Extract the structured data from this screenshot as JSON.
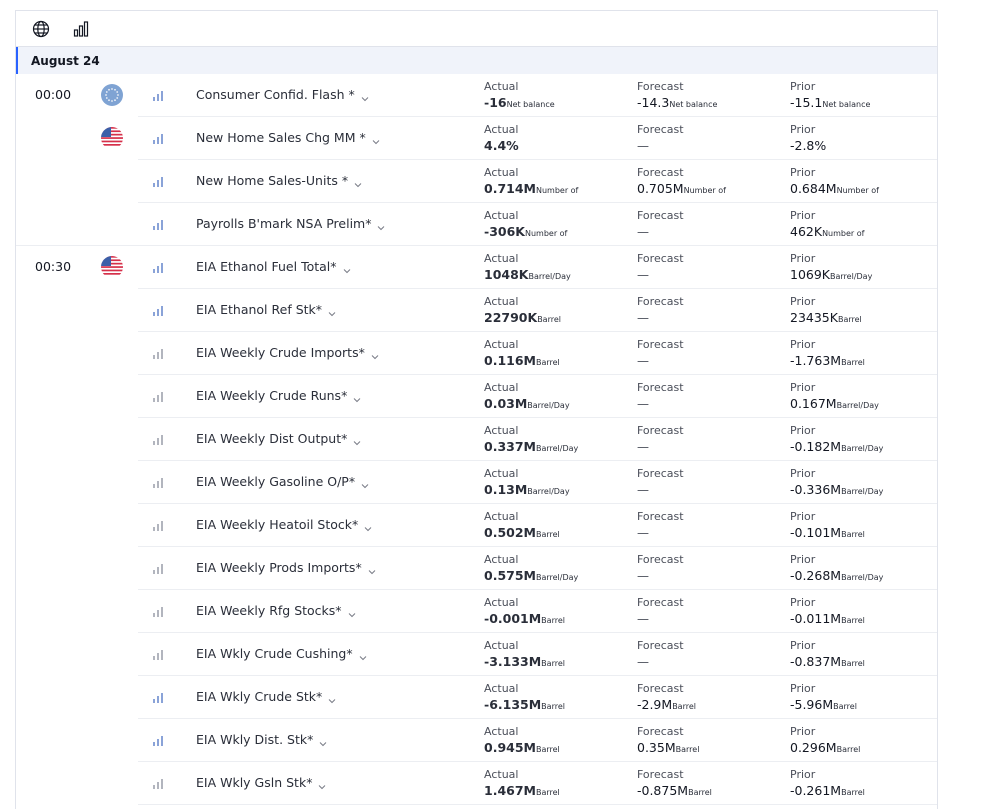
{
  "toolbar": {
    "icons": [
      "globe-icon",
      "importance-bars-icon"
    ]
  },
  "date_header": "August 24",
  "labels": {
    "actual": "Actual",
    "forecast": "Forecast",
    "prior": "Prior"
  },
  "colors": {
    "accent": "#2962ff",
    "importance_high": "#8aa3d8",
    "importance_low": "#b2b5be"
  },
  "events": [
    {
      "time": "00:00",
      "flag": "eu",
      "importance": "high",
      "name": "Consumer Confid. Flash *",
      "actual": {
        "v": "-16",
        "u": "Net balance"
      },
      "forecast": {
        "v": "-14.3",
        "u": "Net balance"
      },
      "prior": {
        "v": "-15.1",
        "u": "Net balance"
      }
    },
    {
      "time": "",
      "flag": "us",
      "importance": "high",
      "name": "New Home Sales Chg MM *",
      "actual": {
        "v": "4.4%",
        "u": ""
      },
      "forecast": {
        "v": "—",
        "u": ""
      },
      "prior": {
        "v": "-2.8%",
        "u": ""
      }
    },
    {
      "time": "",
      "flag": "",
      "importance": "high",
      "name": "New Home Sales-Units *",
      "actual": {
        "v": "0.714M",
        "u": "Number of"
      },
      "forecast": {
        "v": "0.705M",
        "u": "Number of"
      },
      "prior": {
        "v": "0.684M",
        "u": "Number of"
      }
    },
    {
      "time": "",
      "flag": "",
      "importance": "high",
      "name": "Payrolls B'mark NSA Prelim*",
      "actual": {
        "v": "-306K",
        "u": "Number of"
      },
      "forecast": {
        "v": "—",
        "u": ""
      },
      "prior": {
        "v": "462K",
        "u": "Number of"
      }
    },
    {
      "time": "00:30",
      "flag": "us",
      "importance": "high",
      "name": "EIA Ethanol Fuel Total*",
      "actual": {
        "v": "1048K",
        "u": "Barrel/Day"
      },
      "forecast": {
        "v": "—",
        "u": ""
      },
      "prior": {
        "v": "1069K",
        "u": "Barrel/Day"
      }
    },
    {
      "time": "",
      "flag": "",
      "importance": "high",
      "name": "EIA Ethanol Ref Stk*",
      "actual": {
        "v": "22790K",
        "u": "Barrel"
      },
      "forecast": {
        "v": "—",
        "u": ""
      },
      "prior": {
        "v": "23435K",
        "u": "Barrel"
      }
    },
    {
      "time": "",
      "flag": "",
      "importance": "low",
      "name": "EIA Weekly Crude Imports*",
      "actual": {
        "v": "0.116M",
        "u": "Barrel"
      },
      "forecast": {
        "v": "—",
        "u": ""
      },
      "prior": {
        "v": "-1.763M",
        "u": "Barrel"
      }
    },
    {
      "time": "",
      "flag": "",
      "importance": "low",
      "name": "EIA Weekly Crude Runs*",
      "actual": {
        "v": "0.03M",
        "u": "Barrel/Day"
      },
      "forecast": {
        "v": "—",
        "u": ""
      },
      "prior": {
        "v": "0.167M",
        "u": "Barrel/Day"
      }
    },
    {
      "time": "",
      "flag": "",
      "importance": "low",
      "name": "EIA Weekly Dist Output*",
      "actual": {
        "v": "0.337M",
        "u": "Barrel/Day"
      },
      "forecast": {
        "v": "—",
        "u": ""
      },
      "prior": {
        "v": "-0.182M",
        "u": "Barrel/Day"
      }
    },
    {
      "time": "",
      "flag": "",
      "importance": "low",
      "name": "EIA Weekly Gasoline O/P*",
      "actual": {
        "v": "0.13M",
        "u": "Barrel/Day"
      },
      "forecast": {
        "v": "—",
        "u": ""
      },
      "prior": {
        "v": "-0.336M",
        "u": "Barrel/Day"
      }
    },
    {
      "time": "",
      "flag": "",
      "importance": "low",
      "name": "EIA Weekly Heatoil Stock*",
      "actual": {
        "v": "0.502M",
        "u": "Barrel"
      },
      "forecast": {
        "v": "—",
        "u": ""
      },
      "prior": {
        "v": "-0.101M",
        "u": "Barrel"
      }
    },
    {
      "time": "",
      "flag": "",
      "importance": "low",
      "name": "EIA Weekly Prods Imports*",
      "actual": {
        "v": "0.575M",
        "u": "Barrel/Day"
      },
      "forecast": {
        "v": "—",
        "u": ""
      },
      "prior": {
        "v": "-0.268M",
        "u": "Barrel/Day"
      }
    },
    {
      "time": "",
      "flag": "",
      "importance": "low",
      "name": "EIA Weekly Rfg Stocks*",
      "actual": {
        "v": "-0.001M",
        "u": "Barrel"
      },
      "forecast": {
        "v": "—",
        "u": ""
      },
      "prior": {
        "v": "-0.011M",
        "u": "Barrel"
      }
    },
    {
      "time": "",
      "flag": "",
      "importance": "low",
      "name": "EIA Wkly Crude Cushing*",
      "actual": {
        "v": "-3.133M",
        "u": "Barrel"
      },
      "forecast": {
        "v": "—",
        "u": ""
      },
      "prior": {
        "v": "-0.837M",
        "u": "Barrel"
      }
    },
    {
      "time": "",
      "flag": "",
      "importance": "high",
      "name": "EIA Wkly Crude Stk*",
      "actual": {
        "v": "-6.135M",
        "u": "Barrel"
      },
      "forecast": {
        "v": "-2.9M",
        "u": "Barrel"
      },
      "prior": {
        "v": "-5.96M",
        "u": "Barrel"
      }
    },
    {
      "time": "",
      "flag": "",
      "importance": "high",
      "name": "EIA Wkly Dist. Stk*",
      "actual": {
        "v": "0.945M",
        "u": "Barrel"
      },
      "forecast": {
        "v": "0.35M",
        "u": "Barrel"
      },
      "prior": {
        "v": "0.296M",
        "u": "Barrel"
      }
    },
    {
      "time": "",
      "flag": "",
      "importance": "low",
      "name": "EIA Wkly Gsln Stk*",
      "actual": {
        "v": "1.467M",
        "u": "Barrel"
      },
      "forecast": {
        "v": "-0.875M",
        "u": "Barrel"
      },
      "prior": {
        "v": "-0.261M",
        "u": "Barrel"
      }
    }
  ]
}
